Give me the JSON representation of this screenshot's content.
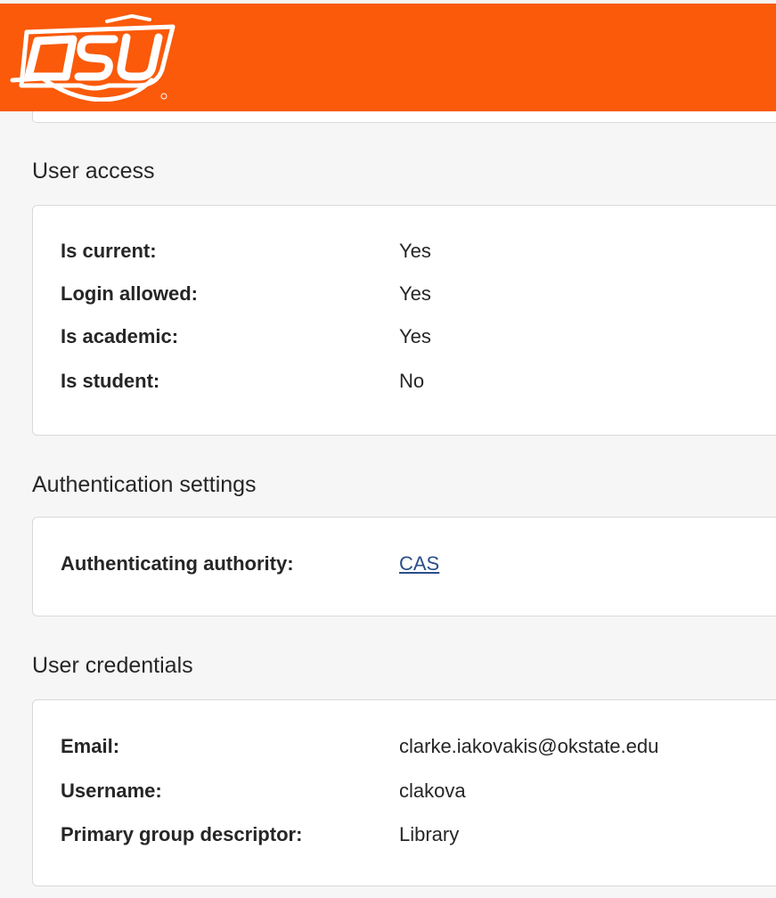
{
  "header": {
    "logo_text": "OSU",
    "colors": {
      "brand": "#fa5a0a",
      "logo": "#ffffff"
    },
    "logo_icon": "osu-logo"
  },
  "sections": {
    "user_access": {
      "title": "User access",
      "rows": [
        {
          "label": "Is current:",
          "value": "Yes"
        },
        {
          "label": "Login allowed:",
          "value": "Yes"
        },
        {
          "label": "Is academic:",
          "value": "Yes"
        },
        {
          "label": "Is student:",
          "value": "No"
        }
      ]
    },
    "authentication": {
      "title": "Authentication settings",
      "rows": [
        {
          "label": "Authenticating authority:",
          "value": "CAS"
        }
      ]
    },
    "credentials": {
      "title": "User credentials",
      "rows": [
        {
          "label": "Email:",
          "value": "clarke.iakovakis@okstate.edu"
        },
        {
          "label": "Username:",
          "value": "clakova"
        },
        {
          "label": "Primary group descriptor:",
          "value": "Library"
        }
      ]
    }
  },
  "colors": {
    "link": "#2a4f8a",
    "page_background": "#f6f6f6",
    "card_border": "#d9d9d9"
  }
}
